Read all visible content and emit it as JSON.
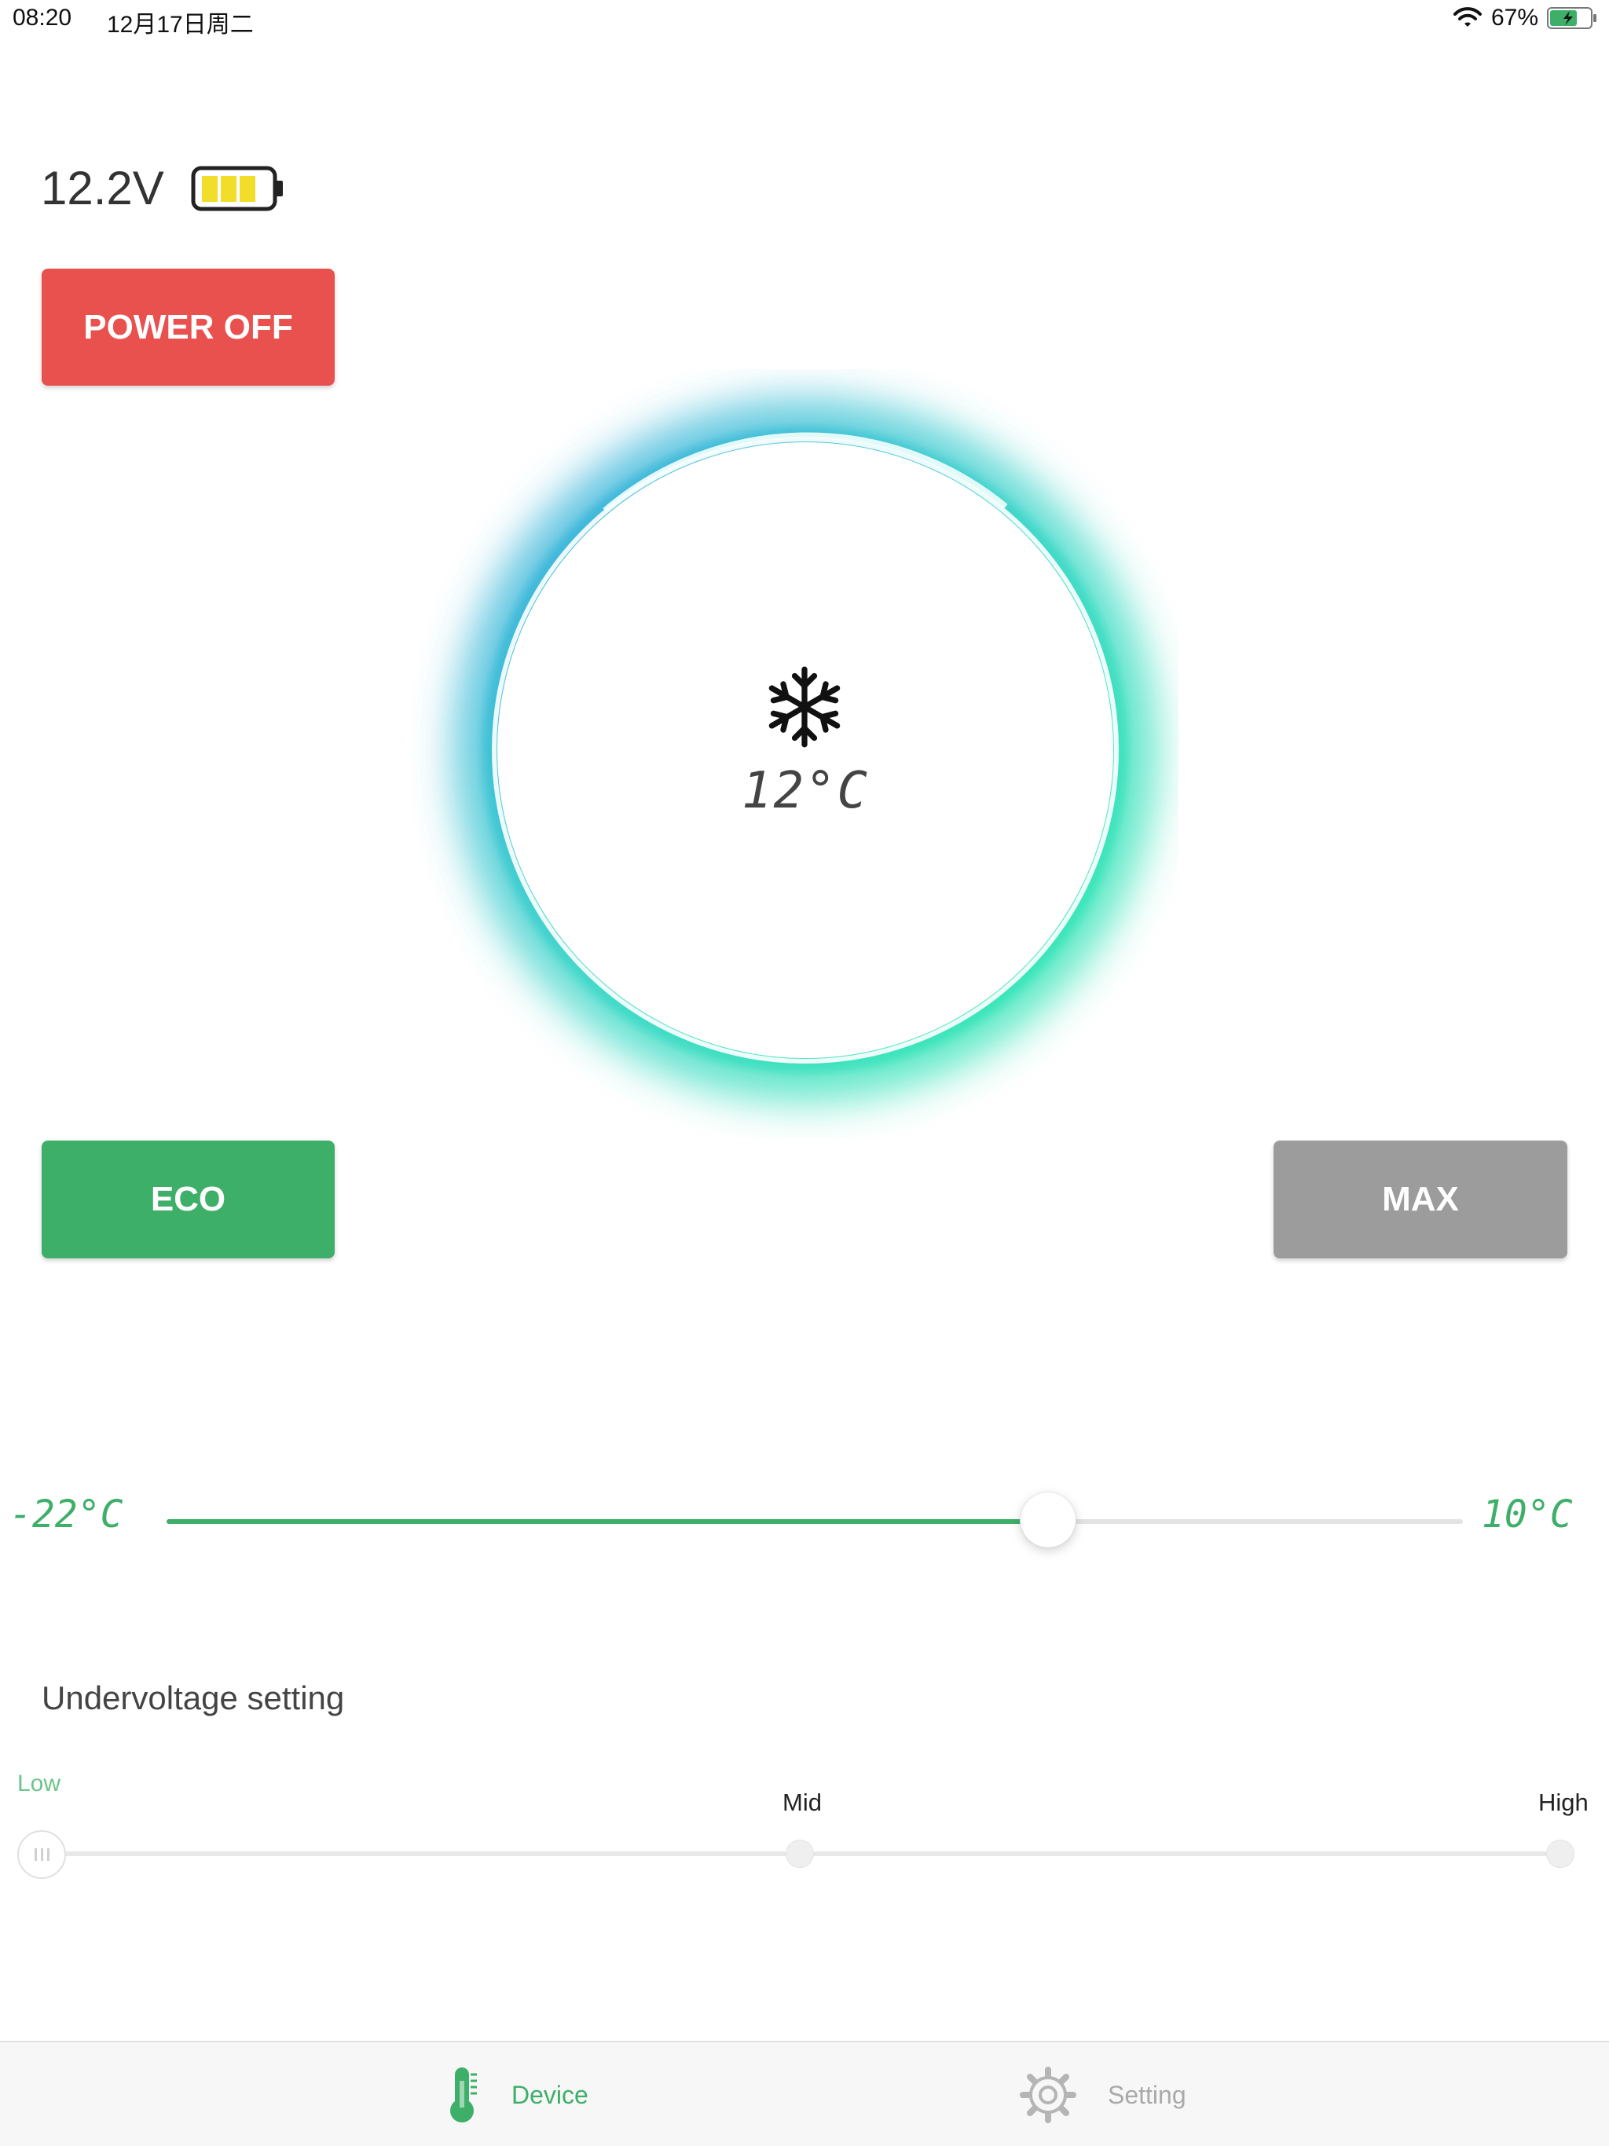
{
  "status_bar": {
    "time": "08:20",
    "date": "12月17日周二",
    "battery_percent": "67%"
  },
  "device": {
    "voltage": "12.2V",
    "power_button_label": "POWER OFF",
    "current_temp": "12°C",
    "eco_label": "ECO",
    "max_label": "MAX"
  },
  "temp_slider": {
    "min_label": "-22°C",
    "max_label": "10°C",
    "fill_fraction": 0.68
  },
  "undervoltage": {
    "title": "Undervoltage setting",
    "low_label": "Low",
    "mid_label": "Mid",
    "high_label": "High",
    "selected": "Low"
  },
  "tabs": {
    "device_label": "Device",
    "setting_label": "Setting"
  },
  "colors": {
    "power": "#e9514f",
    "eco": "#3eaf69",
    "max": "#9c9c9c",
    "accent": "#3eaf69",
    "ring_glow": "#36e0b8"
  },
  "icons": {
    "dial_center": "snowflake-icon",
    "voltage_battery": "battery-icon",
    "tab_device": "thermometer-icon",
    "tab_setting": "gear-icon"
  }
}
